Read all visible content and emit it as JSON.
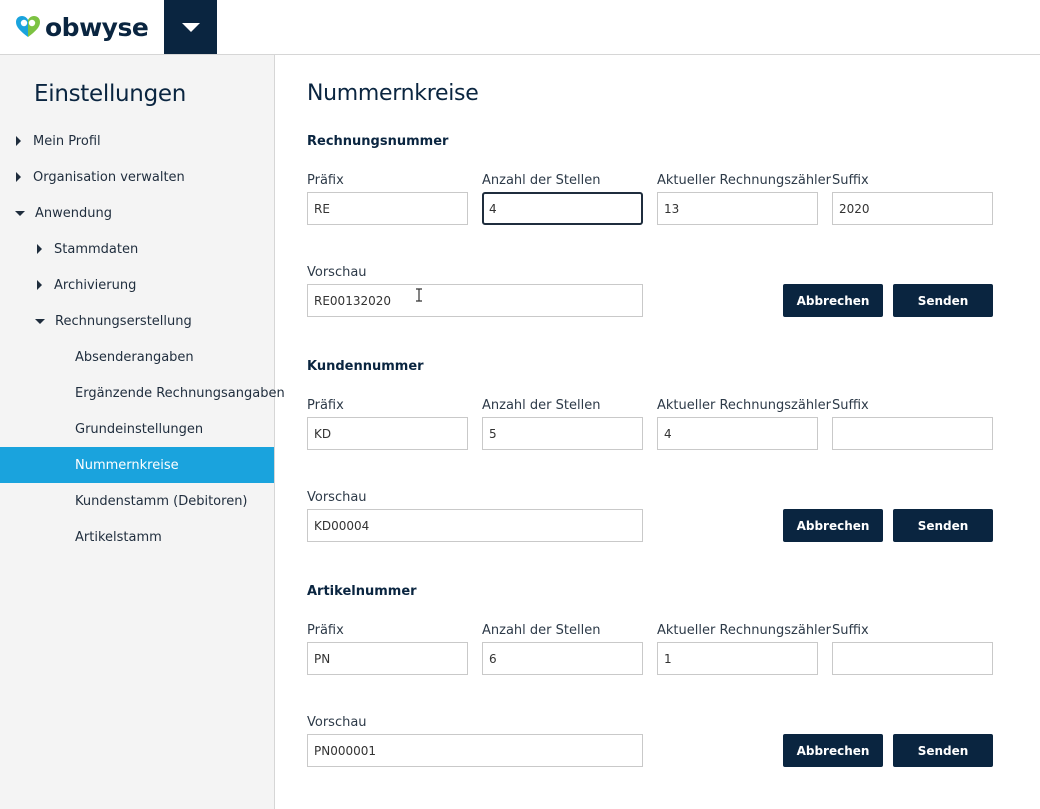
{
  "brand": {
    "name": "obwyse",
    "navy": "#0a2540",
    "accent": "#1aa3dd",
    "logo_green": "#7cc242",
    "logo_blue": "#1aa3dd"
  },
  "header": {
    "menu_icon": "chevron-down-icon"
  },
  "sidebar": {
    "title": "Einstellungen",
    "items": [
      {
        "label": "Mein Profil"
      },
      {
        "label": "Organisation verwalten"
      },
      {
        "label": "Anwendung"
      },
      {
        "label": "Stammdaten"
      },
      {
        "label": "Archivierung"
      },
      {
        "label": "Rechnungserstellung"
      },
      {
        "label": "Absenderangaben"
      },
      {
        "label": "Ergänzende Rechnungsangaben"
      },
      {
        "label": "Grundeinstellungen"
      },
      {
        "label": "Nummernkreise"
      },
      {
        "label": "Kundenstamm (Debitoren)"
      },
      {
        "label": "Artikelstamm"
      }
    ]
  },
  "main": {
    "title": "Nummernkreise",
    "labels": {
      "prefix": "Präfix",
      "digits": "Anzahl der Stellen",
      "counter": "Aktueller Rechnungszähler",
      "suffix": "Suffix",
      "preview": "Vorschau"
    },
    "buttons": {
      "cancel": "Abbrechen",
      "send": "Senden"
    },
    "sections": [
      {
        "title": "Rechnungsnummer",
        "prefix": "RE",
        "digits": "4",
        "counter": "13",
        "suffix": "2020",
        "preview": "RE00132020"
      },
      {
        "title": "Kundennummer",
        "prefix": "KD",
        "digits": "5",
        "counter": "4",
        "suffix": "",
        "preview": "KD00004"
      },
      {
        "title": "Artikelnummer",
        "prefix": "PN",
        "digits": "6",
        "counter": "1",
        "suffix": "",
        "preview": "PN000001"
      }
    ]
  }
}
